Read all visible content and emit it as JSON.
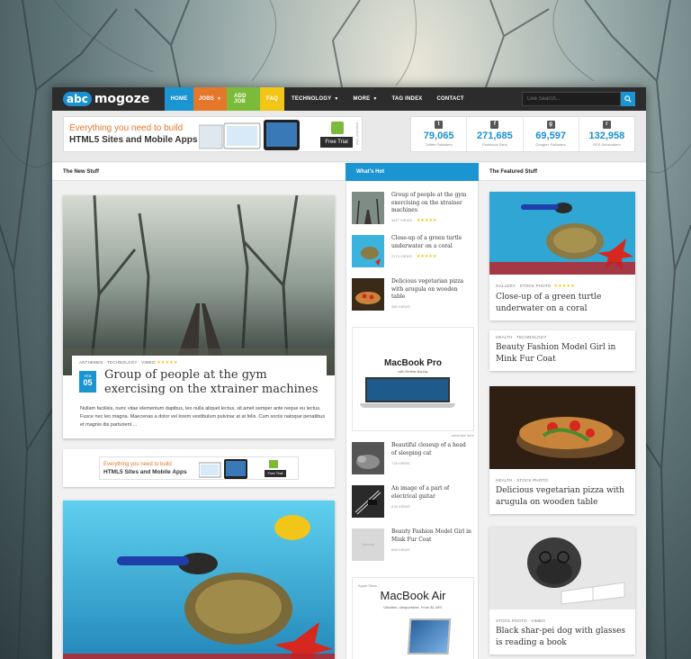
{
  "nav": {
    "logo_badge": "abc",
    "logo_text": "mogoze",
    "items": [
      {
        "label": "HOME"
      },
      {
        "label": "JOBS"
      },
      {
        "label": "ADD JOB"
      },
      {
        "label": "FAQ"
      },
      {
        "label": "TECHNOLOGY"
      },
      {
        "label": "MORE"
      },
      {
        "label": "TAG INDEX"
      },
      {
        "label": "CONTACT"
      }
    ],
    "search_placeholder": "Live Search..."
  },
  "header_ad": {
    "line1": "Everything you need to build",
    "line2": "HTML5 Sites and Mobile Apps",
    "trial": "Free Trial",
    "label": "advertise here"
  },
  "counters": [
    {
      "icon": "twitter-icon",
      "glyph": "t",
      "value": "79,065",
      "label": "Twitter Followers"
    },
    {
      "icon": "facebook-icon",
      "glyph": "f",
      "value": "271,685",
      "label": "Facebook Fans"
    },
    {
      "icon": "googleplus-icon",
      "glyph": "g",
      "value": "69,597",
      "label": "Google+ Followers"
    },
    {
      "icon": "rss-icon",
      "glyph": "r",
      "value": "132,958",
      "label": "RSS Subscribers"
    }
  ],
  "columns": {
    "left": "The New Stuff",
    "mid": "What's Hot",
    "right": "The Featured Stuff"
  },
  "main_post": {
    "meta": "ANTHEMES · TECHNOLOGY · VIMEO",
    "stars": "★★★★★",
    "month": "FEB",
    "day": "05",
    "title": "Group of people at the gym exercising on the xtrainer machines",
    "excerpt": "Nullam facilisis, nunc vitae elementum dapibus, leo nulla aliquet lectus, sit amet semper ante neque eu lectus. Fusce nec leo magna. Maecenas a dolor vel lorem vestibulum pulvinar at at felis. Cum sociis natoque penatibus et magnis dis parturient ..."
  },
  "mid_ad": {
    "line1": "Everything you need to build",
    "line2": "HTML5 Sites and Mobile Apps",
    "trial": "Free Trial"
  },
  "hot": [
    {
      "title": "Group of people at the gym exercising on the xtrainer machines",
      "views": "3427 VIEWS",
      "stars": "★★★★★"
    },
    {
      "title": "Close-up of a green turtle underwater on a coral",
      "views": "2174 VIEWS",
      "stars": "★★★★★"
    },
    {
      "title": "Delicious vegetarian pizza with arugula on wooden table",
      "views": "986 VIEWS",
      "stars": ""
    },
    {
      "title": "Beautiful closeup of a head of sleeping cat",
      "views": "718 VIEWS",
      "stars": ""
    },
    {
      "title": "An image of a part of electrical guitar",
      "views": "676 VIEWS",
      "stars": ""
    },
    {
      "title": "Beauty Fashion Model Girl in Mink Fur Coat",
      "views": "668 VIEWS",
      "stars": ""
    }
  ],
  "macbook_pro_ad": {
    "title": "MacBook Pro",
    "subtitle": "with Retina display",
    "label": "advertise here"
  },
  "macbook_air_ad": {
    "store": "Apple Store",
    "title": "MacBook Air",
    "subtitle": "Ultrathin, ultraportable. From $1,499."
  },
  "placeholder_thumb": "Nobody",
  "featured": [
    {
      "meta": "GALLERY · STOCK PHOTO",
      "stars": "★★★★★",
      "title": "Close-up of a green turtle underwater on a coral"
    },
    {
      "meta": "HEALTH · TECHNOLOGY",
      "stars": "",
      "title": "Beauty Fashion Model Girl in Mink Fur Coat"
    },
    {
      "meta": "HEALTH · STOCK PHOTO",
      "stars": "",
      "title": "Delicious vegetarian pizza with arugula on wooden table"
    },
    {
      "meta": "STOCK PHOTO · VIMEO",
      "stars": "",
      "title": "Black shar-pei dog with glasses is reading a book"
    }
  ]
}
